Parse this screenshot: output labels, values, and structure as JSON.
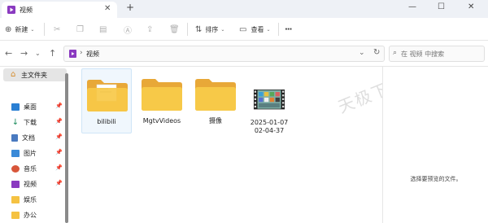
{
  "window": {
    "tab_title": "视频",
    "new_tab": "+",
    "controls": {
      "minimize": "—",
      "maximize": "☐",
      "close": "✕"
    }
  },
  "toolbar": {
    "new_label": "新建",
    "sort_label": "排序",
    "view_label": "查看",
    "more": "···"
  },
  "address": {
    "breadcrumb": "视频",
    "search_placeholder": "在 视频 中搜索"
  },
  "sidebar": {
    "home_label": "主文件夹",
    "items": [
      {
        "label": "桌面",
        "icon": "desktop-icon",
        "color": "#2a7fd3"
      },
      {
        "label": "下载",
        "icon": "download-icon",
        "color": "#1a8a5a"
      },
      {
        "label": "文档",
        "icon": "document-icon",
        "color": "#4a7ac0"
      },
      {
        "label": "图片",
        "icon": "picture-icon",
        "color": "#3a8ad8"
      },
      {
        "label": "音乐",
        "icon": "music-icon",
        "color": "#d8563a"
      },
      {
        "label": "视频",
        "icon": "video-icon",
        "color": "#8a3ac0"
      },
      {
        "label": "娱乐",
        "icon": "folder-icon",
        "color": "#f5c242"
      },
      {
        "label": "办公",
        "icon": "folder-icon",
        "color": "#f5c242"
      }
    ]
  },
  "files": [
    {
      "name": "bilibili",
      "type": "folder",
      "selected": true
    },
    {
      "name": "MgtvVideos",
      "type": "folder"
    },
    {
      "name": "摄像",
      "type": "folder"
    },
    {
      "name_line1": "2025-01-07",
      "name_line2": "02-04-37",
      "type": "video"
    }
  ],
  "preview": {
    "empty_text": "选择要预览的文件。"
  },
  "watermark": "天极下载站",
  "colors": {
    "folder": "#f5c242",
    "accent": "#0067c0"
  }
}
